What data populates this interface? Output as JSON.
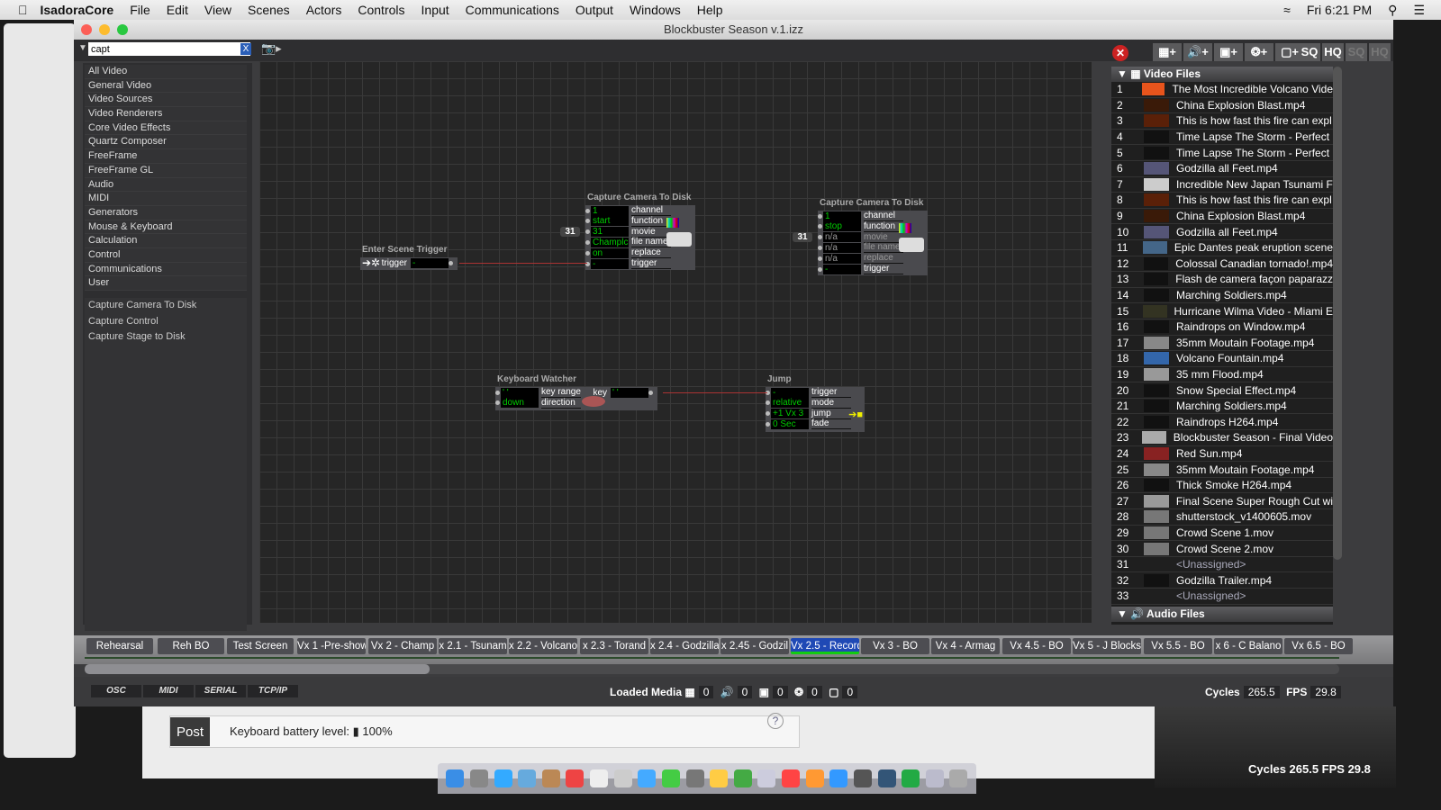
{
  "menubar": {
    "app": "IsadoraCore",
    "items": [
      "File",
      "Edit",
      "View",
      "Scenes",
      "Actors",
      "Controls",
      "Input",
      "Communications",
      "Output",
      "Windows",
      "Help"
    ],
    "clock": "Fri 6:21 PM"
  },
  "window": {
    "title": "Blockbuster Season v.1.izz"
  },
  "search": {
    "value": "capt",
    "clear": "X"
  },
  "categories": [
    "All Video",
    "General Video",
    "Video Sources",
    "Video Renderers",
    "Core Video Effects",
    "Quartz Composer",
    "FreeFrame",
    "FreeFrame GL",
    "Audio",
    "MIDI",
    "Generators",
    "Mouse & Keyboard",
    "Calculation",
    "Control",
    "Communications",
    "User"
  ],
  "results": [
    "Capture Camera To Disk",
    "Capture Control",
    "Capture Stage to Disk"
  ],
  "toolbar": {
    "buttons": [
      "SQ",
      "HQ",
      "SQ",
      "HQ"
    ]
  },
  "nodes": [
    {
      "title": "Enter Scene Trigger",
      "outputs": [
        {
          "label": "trigger",
          "value": "-"
        }
      ]
    },
    {
      "title": "Capture Camera To Disk",
      "ext": "31",
      "inputs": [
        {
          "value": "1",
          "label": "channel"
        },
        {
          "value": "start",
          "label": "function"
        },
        {
          "value": "31",
          "label": "movie"
        },
        {
          "value": "Champlc",
          "label": "file name"
        },
        {
          "value": "on",
          "label": "replace"
        },
        {
          "value": "-",
          "label": "trigger"
        }
      ]
    },
    {
      "title": "Capture Camera To Disk",
      "ext": "31",
      "inputs": [
        {
          "value": "1",
          "label": "channel"
        },
        {
          "value": "stop",
          "label": "function"
        },
        {
          "value": "n/a",
          "label": "movie"
        },
        {
          "value": "n/a",
          "label": "file name"
        },
        {
          "value": "n/a",
          "label": "replace"
        },
        {
          "value": "-",
          "label": "trigger"
        }
      ]
    },
    {
      "title": "Keyboard Watcher",
      "inputs": [
        {
          "value": "' '",
          "label": "key range"
        },
        {
          "value": "down",
          "label": "direction"
        }
      ],
      "outputs": [
        {
          "label": "key",
          "value": "' '"
        }
      ]
    },
    {
      "title": "Jump",
      "inputs": [
        {
          "value": "-",
          "label": "trigger"
        },
        {
          "value": "relative",
          "label": "mode"
        },
        {
          "value": "+1 Vx 3",
          "label": "jump"
        },
        {
          "value": "0 Sec",
          "label": "fade"
        }
      ]
    }
  ],
  "video_files": {
    "header": "Video Files",
    "items": [
      [
        "1",
        "The Most Incredible Volcano Vide",
        "#e8541c"
      ],
      [
        "2",
        "China Explosion Blast.mp4",
        "#3a1a08"
      ],
      [
        "3",
        "This is how fast this fire can expl",
        "#5a2008"
      ],
      [
        "4",
        "Time Lapse  The Storm - Perfect",
        "#111"
      ],
      [
        "5",
        "Time Lapse  The Storm - Perfect",
        "#111"
      ],
      [
        "6",
        "Godzilla all Feet.mp4",
        "#557"
      ],
      [
        "7",
        "Incredible New Japan Tsunami F",
        "#ccc"
      ],
      [
        "8",
        "This is how fast this fire can expl",
        "#5a2008"
      ],
      [
        "9",
        "China Explosion Blast.mp4",
        "#3a1a08"
      ],
      [
        "10",
        "Godzilla all Feet.mp4",
        "#557"
      ],
      [
        "11",
        "Epic Dantes peak eruption scene",
        "#468"
      ],
      [
        "12",
        "Colossal Canadian tornado!.mp4",
        "#111"
      ],
      [
        "13",
        "Flash de camera façon paparazz",
        "#111"
      ],
      [
        "14",
        "Marching Soldiers.mp4",
        "#111"
      ],
      [
        "15",
        "Hurricane Wilma Video - Miami E",
        "#332"
      ],
      [
        "16",
        "Raindrops on Window.mp4",
        "#111"
      ],
      [
        "17",
        "35mm Moutain Footage.mp4",
        "#888"
      ],
      [
        "18",
        "Volcano Fountain.mp4",
        "#36a"
      ],
      [
        "19",
        "35 mm Flood.mp4",
        "#999"
      ],
      [
        "20",
        "Snow Special Effect.mp4",
        "#111"
      ],
      [
        "21",
        "Marching Soldiers.mp4",
        "#111"
      ],
      [
        "22",
        "Raindrops H264.mp4",
        "#111"
      ],
      [
        "23",
        "Blockbuster Season - Final Video",
        "#aaa"
      ],
      [
        "24",
        "Red Sun.mp4",
        "#822"
      ],
      [
        "25",
        "35mm Moutain Footage.mp4",
        "#888"
      ],
      [
        "26",
        "Thick Smoke H264.mp4",
        "#111"
      ],
      [
        "27",
        "Final Scene Super Rough Cut wi",
        "#999"
      ],
      [
        "28",
        "shutterstock_v1400605.mov",
        "#777"
      ],
      [
        "29",
        "Crowd Scene 1.mov",
        "#777"
      ],
      [
        "30",
        "Crowd Scene 2.mov",
        "#777"
      ],
      [
        "31",
        "<Unassigned>",
        ""
      ],
      [
        "32",
        "Godzilla Trailer.mp4",
        "#111"
      ],
      [
        "33",
        "<Unassigned>",
        ""
      ]
    ]
  },
  "audio_files": {
    "header": "Audio Files"
  },
  "scenes": {
    "items": [
      "Rehearsal",
      "Reh BO",
      "Test Screen",
      "Vx 1 -Pre-show",
      "Vx 2 - Champ",
      "x 2.1 - Tsunam",
      "x 2.2 - Volcano",
      "x 2.3 - Torand",
      "x 2.4 - Godzilla",
      "x 2.45 - Godzil",
      "Vx 2.5 - Record",
      "Vx 3 - BO",
      "Vx 4 - Armag",
      "Vx 4.5 - BO",
      "Vx 5 - J Blocks",
      "Vx 5.5 - BO",
      "x 6 - C Balano",
      "Vx 6.5 - BO"
    ],
    "active": 10
  },
  "status": {
    "protocols": [
      "OSC",
      "MIDI",
      "SERIAL",
      "TCP/IP"
    ],
    "loaded_media_label": "Loaded Media",
    "counts": [
      "0",
      "0",
      "0",
      "0",
      "0"
    ],
    "cycles_label": "Cycles",
    "cycles": "265.5",
    "fps_label": "FPS",
    "fps": "29.8"
  },
  "desktop": {
    "post": "Post",
    "battery_label": "Keyboard battery level:",
    "battery": "100%",
    "help": "?",
    "cycles_text": "Cycles  265.5   FPS  29.8"
  }
}
